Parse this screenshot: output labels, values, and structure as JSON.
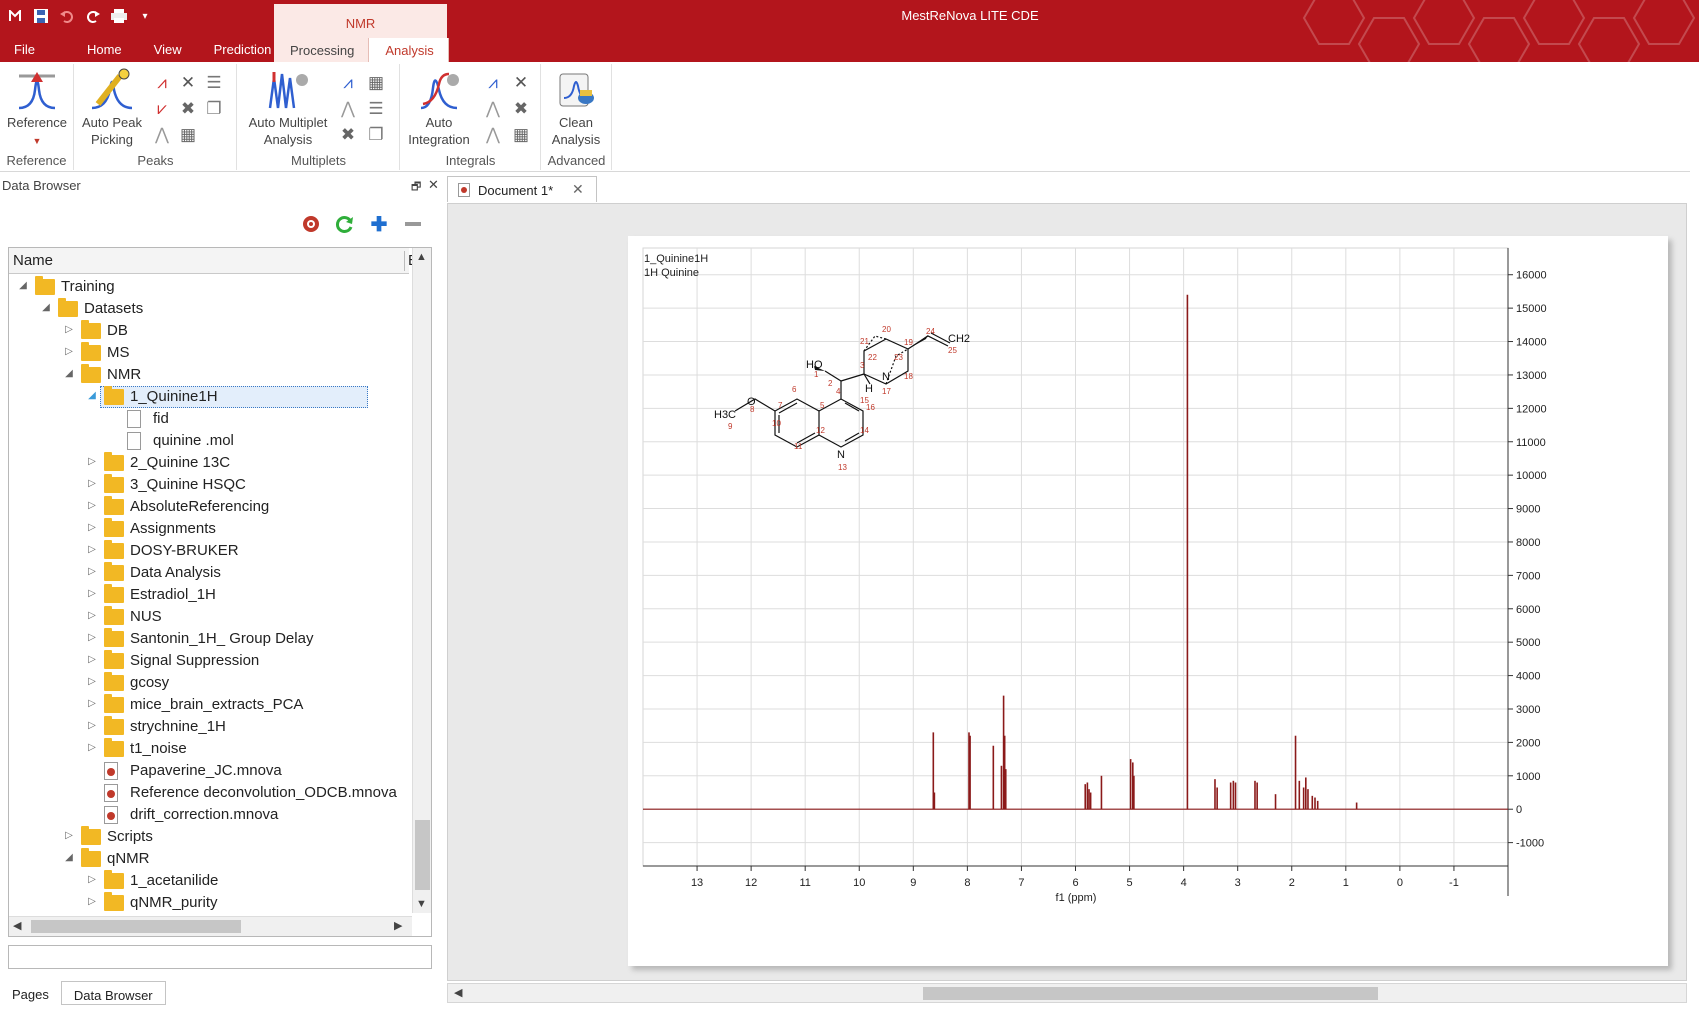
{
  "app": {
    "title": "MestReNova LITE CDE",
    "accent": "#b3151c"
  },
  "quick_access": [
    "app-icon",
    "save-icon",
    "undo-icon",
    "redo-icon",
    "print-icon",
    "customize-icon"
  ],
  "tabs": [
    "File",
    "Home",
    "View",
    "Prediction"
  ],
  "context_group": {
    "label": "NMR",
    "tabs": [
      "Processing",
      "Analysis"
    ],
    "active": "Analysis"
  },
  "ribbon": {
    "groups": [
      {
        "label": "Reference",
        "big_buttons": [
          "Reference"
        ]
      },
      {
        "label": "Peaks",
        "big_buttons": [
          "Auto Peak Picking"
        ]
      },
      {
        "label": "Multiplets",
        "big_buttons": [
          "Auto Multiplet Analysis"
        ]
      },
      {
        "label": "Integrals",
        "big_buttons": [
          "Auto Integration"
        ]
      },
      {
        "label": "Advanced",
        "big_buttons": [
          "Clean Analysis"
        ]
      }
    ],
    "reference_l1": "Reference",
    "peaks_l1": "Auto Peak",
    "peaks_l2": "Picking",
    "mult_l1": "Auto Multiplet",
    "mult_l2": "Analysis",
    "integ_l1": "Auto",
    "integ_l2": "Integration",
    "adv_l1": "Clean",
    "adv_l2": "Analysis"
  },
  "data_browser": {
    "title": "Data Browser",
    "column_name": "Name",
    "column_second": "E",
    "toolbar": [
      "settings-icon",
      "refresh-icon",
      "add-icon",
      "remove-icon"
    ],
    "tree": [
      {
        "label": "Training",
        "level": 0,
        "type": "folder",
        "state": "expanded"
      },
      {
        "label": "Datasets",
        "level": 1,
        "type": "folder",
        "state": "expanded"
      },
      {
        "label": "DB",
        "level": 2,
        "type": "folder",
        "state": "collapsed"
      },
      {
        "label": "MS",
        "level": 2,
        "type": "folder",
        "state": "collapsed"
      },
      {
        "label": "NMR",
        "level": 2,
        "type": "folder",
        "state": "expanded"
      },
      {
        "label": "1_Quinine1H",
        "level": 3,
        "type": "folder",
        "state": "expanded",
        "selected": true
      },
      {
        "label": "fid",
        "level": 4,
        "type": "file",
        "state": "none"
      },
      {
        "label": "quinine .mol",
        "level": 4,
        "type": "file",
        "state": "none"
      },
      {
        "label": "2_Quinine 13C",
        "level": 3,
        "type": "folder",
        "state": "collapsed"
      },
      {
        "label": "3_Quinine HSQC",
        "level": 3,
        "type": "folder",
        "state": "collapsed"
      },
      {
        "label": "AbsoluteReferencing",
        "level": 3,
        "type": "folder",
        "state": "collapsed"
      },
      {
        "label": "Assignments",
        "level": 3,
        "type": "folder",
        "state": "collapsed"
      },
      {
        "label": "DOSY-BRUKER",
        "level": 3,
        "type": "folder",
        "state": "collapsed"
      },
      {
        "label": "Data Analysis",
        "level": 3,
        "type": "folder",
        "state": "collapsed"
      },
      {
        "label": "Estradiol_1H",
        "level": 3,
        "type": "folder",
        "state": "collapsed"
      },
      {
        "label": "NUS",
        "level": 3,
        "type": "folder",
        "state": "collapsed"
      },
      {
        "label": "Santonin_1H_ Group Delay",
        "level": 3,
        "type": "folder",
        "state": "collapsed"
      },
      {
        "label": "Signal Suppression",
        "level": 3,
        "type": "folder",
        "state": "collapsed"
      },
      {
        "label": "gcosy",
        "level": 3,
        "type": "folder",
        "state": "collapsed"
      },
      {
        "label": "mice_brain_extracts_PCA",
        "level": 3,
        "type": "folder",
        "state": "collapsed"
      },
      {
        "label": "strychnine_1H",
        "level": 3,
        "type": "folder",
        "state": "collapsed"
      },
      {
        "label": "t1_noise",
        "level": 3,
        "type": "folder",
        "state": "collapsed"
      },
      {
        "label": "Papaverine_JC.mnova",
        "level": 3,
        "type": "mnova",
        "state": "none"
      },
      {
        "label": "Reference deconvolution_ODCB.mnova",
        "level": 3,
        "type": "mnova",
        "state": "none"
      },
      {
        "label": "drift_correction.mnova",
        "level": 3,
        "type": "mnova",
        "state": "none"
      },
      {
        "label": "Scripts",
        "level": 2,
        "type": "folder",
        "state": "collapsed"
      },
      {
        "label": "qNMR",
        "level": 2,
        "type": "folder",
        "state": "expanded"
      },
      {
        "label": "1_acetanilide",
        "level": 3,
        "type": "folder",
        "state": "collapsed"
      },
      {
        "label": "qNMR_purity",
        "level": 3,
        "type": "folder",
        "state": "collapsed"
      }
    ],
    "filter_value": "",
    "bottom_tabs": [
      "Pages",
      "Data Browser"
    ],
    "active_bottom_tab": "Data Browser"
  },
  "document": {
    "tab_label": "Document 1*"
  },
  "chart_data": {
    "type": "line",
    "title": "1_Quinine1H",
    "subtitle": "1H Quinine",
    "xlabel": "f1 (ppm)",
    "ylabel": "",
    "xlim": [
      14.0,
      -2.0
    ],
    "ylim": [
      -1700,
      16800
    ],
    "x_ticks": [
      13,
      12,
      11,
      10,
      9,
      8,
      7,
      6,
      5,
      4,
      3,
      2,
      1,
      0,
      -1
    ],
    "y_ticks": [
      16000,
      15000,
      14000,
      13000,
      12000,
      11000,
      10000,
      9000,
      8000,
      7000,
      6000,
      5000,
      4000,
      3000,
      2000,
      1000,
      0,
      -1000
    ],
    "grid": true,
    "line_color": "#8b1a1a",
    "peaks": [
      {
        "ppm": 8.63,
        "height": 2300
      },
      {
        "ppm": 8.61,
        "height": 500
      },
      {
        "ppm": 7.97,
        "height": 2300
      },
      {
        "ppm": 7.95,
        "height": 2200
      },
      {
        "ppm": 7.52,
        "height": 1900
      },
      {
        "ppm": 7.37,
        "height": 1300
      },
      {
        "ppm": 7.33,
        "height": 3400
      },
      {
        "ppm": 7.31,
        "height": 2200
      },
      {
        "ppm": 7.29,
        "height": 1200
      },
      {
        "ppm": 5.82,
        "height": 750
      },
      {
        "ppm": 5.78,
        "height": 800
      },
      {
        "ppm": 5.75,
        "height": 600
      },
      {
        "ppm": 5.72,
        "height": 500
      },
      {
        "ppm": 5.52,
        "height": 1000
      },
      {
        "ppm": 4.98,
        "height": 1500
      },
      {
        "ppm": 4.94,
        "height": 1400
      },
      {
        "ppm": 4.92,
        "height": 1000
      },
      {
        "ppm": 3.93,
        "height": 15400
      },
      {
        "ppm": 3.42,
        "height": 900
      },
      {
        "ppm": 3.38,
        "height": 650
      },
      {
        "ppm": 3.13,
        "height": 800
      },
      {
        "ppm": 3.08,
        "height": 850
      },
      {
        "ppm": 3.04,
        "height": 800
      },
      {
        "ppm": 2.68,
        "height": 850
      },
      {
        "ppm": 2.64,
        "height": 800
      },
      {
        "ppm": 2.3,
        "height": 450
      },
      {
        "ppm": 1.93,
        "height": 2200
      },
      {
        "ppm": 1.86,
        "height": 850
      },
      {
        "ppm": 1.78,
        "height": 650
      },
      {
        "ppm": 1.74,
        "height": 950
      },
      {
        "ppm": 1.7,
        "height": 600
      },
      {
        "ppm": 1.62,
        "height": 400
      },
      {
        "ppm": 1.57,
        "height": 350
      },
      {
        "ppm": 1.52,
        "height": 250
      },
      {
        "ppm": 0.8,
        "height": 200
      }
    ]
  },
  "molecule": {
    "atoms": [
      "HO",
      "H",
      "N",
      "O",
      "N",
      "CH2",
      "H3C"
    ],
    "numbers": [
      "1",
      "2",
      "3",
      "4",
      "5",
      "6",
      "7",
      "8",
      "9",
      "10",
      "11",
      "12",
      "13",
      "14",
      "15",
      "16",
      "17",
      "18",
      "19",
      "20",
      "21",
      "22",
      "23",
      "24",
      "25"
    ]
  }
}
